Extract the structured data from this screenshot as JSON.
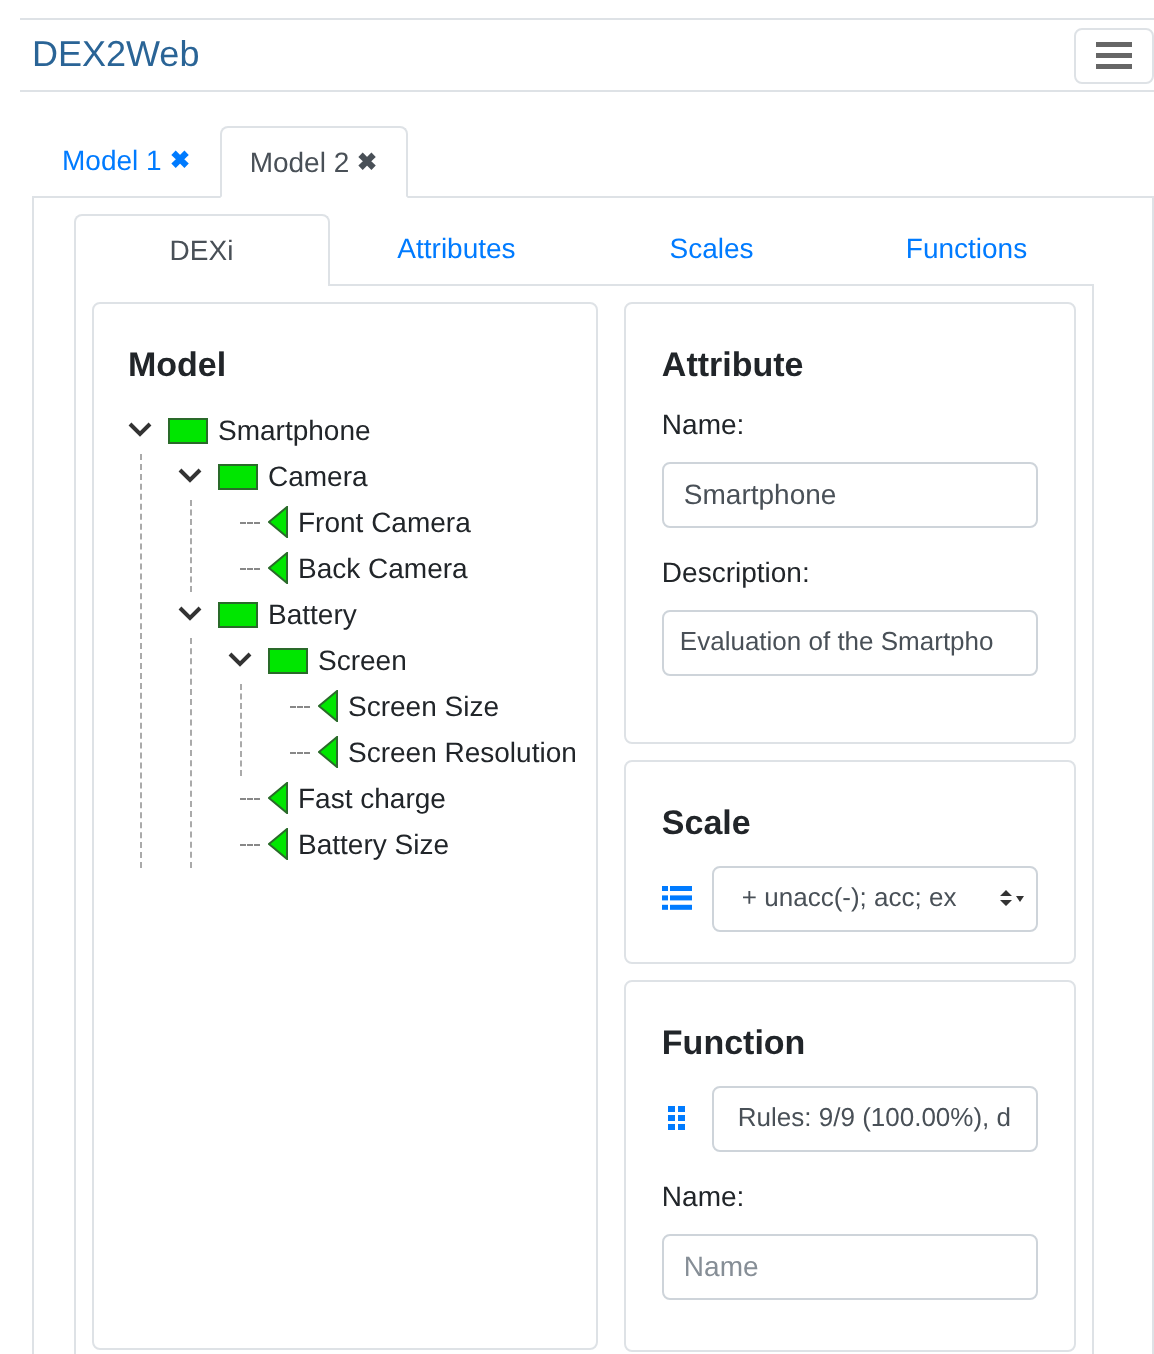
{
  "navbar": {
    "brand": "DEX2Web"
  },
  "model_tabs": [
    {
      "label": "Model 1",
      "close": "✖",
      "selected": false
    },
    {
      "label": "Model 2",
      "close": "✖",
      "selected": true
    }
  ],
  "view_tabs": [
    {
      "label": "DEXi",
      "selected": true
    },
    {
      "label": "Attributes",
      "selected": false
    },
    {
      "label": "Scales",
      "selected": false
    },
    {
      "label": "Functions",
      "selected": false
    }
  ],
  "model": {
    "title": "Model",
    "tree": [
      {
        "label": "Smartphone",
        "kind": "aggregate",
        "expanded": true,
        "children": [
          {
            "label": "Camera",
            "kind": "aggregate",
            "expanded": true,
            "children": [
              {
                "label": "Front Camera",
                "kind": "basic"
              },
              {
                "label": "Back Camera",
                "kind": "basic"
              }
            ]
          },
          {
            "label": "Battery",
            "kind": "aggregate",
            "expanded": true,
            "children": [
              {
                "label": "Screen",
                "kind": "aggregate",
                "expanded": true,
                "children": [
                  {
                    "label": "Screen Size",
                    "kind": "basic"
                  },
                  {
                    "label": "Screen Resolution",
                    "kind": "basic"
                  }
                ]
              },
              {
                "label": "Fast charge",
                "kind": "basic"
              },
              {
                "label": "Battery Size",
                "kind": "basic"
              }
            ]
          }
        ]
      }
    ]
  },
  "attribute": {
    "title": "Attribute",
    "name_label": "Name:",
    "name_value": "Smartphone",
    "description_label": "Description:",
    "description_value": "Evaluation of the Smartpho"
  },
  "scale": {
    "title": "Scale",
    "value": "+ unacc(-); acc; ex"
  },
  "function": {
    "title": "Function",
    "value": "Rules: 9/9 (100.00%), d",
    "name_label": "Name:",
    "name_placeholder": "Name"
  }
}
